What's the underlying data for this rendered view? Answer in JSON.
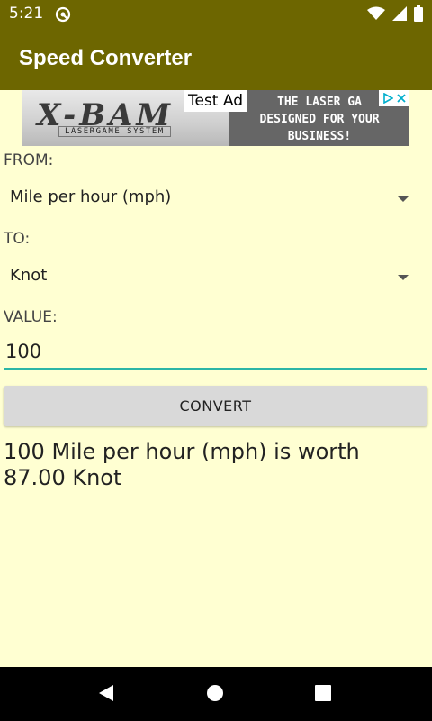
{
  "status_bar": {
    "time": "5:21",
    "icons": [
      "sync-icon",
      "wifi-icon",
      "signal-icon",
      "battery-icon"
    ]
  },
  "app_bar": {
    "title": "Speed Converter",
    "color": "#6D6600"
  },
  "ad": {
    "label": "Test Ad",
    "logo_text": "X-BAM",
    "logo_subtext": "LASERGAME SYSTEM",
    "headline_lines": [
      "THE LASER GA",
      "DESIGNED FOR YOUR",
      "BUSINESS!"
    ],
    "choices_icons": [
      "ad-choices-icon",
      "close-icon"
    ]
  },
  "form": {
    "from_label": "FROM:",
    "from_value": "Mile per hour (mph)",
    "to_label": "TO:",
    "to_value": "Knot",
    "value_label": "VALUE:",
    "value_input": "100",
    "convert_label": "CONVERT"
  },
  "result": {
    "text": "100 Mile per hour (mph) is worth 87.00 Knot"
  },
  "colors": {
    "background": "#FFFFD2",
    "accent": "#2BB5A6",
    "button": "#D9D9D9"
  },
  "nav_bar": {
    "icons": [
      "back-icon",
      "home-icon",
      "recents-icon"
    ]
  }
}
